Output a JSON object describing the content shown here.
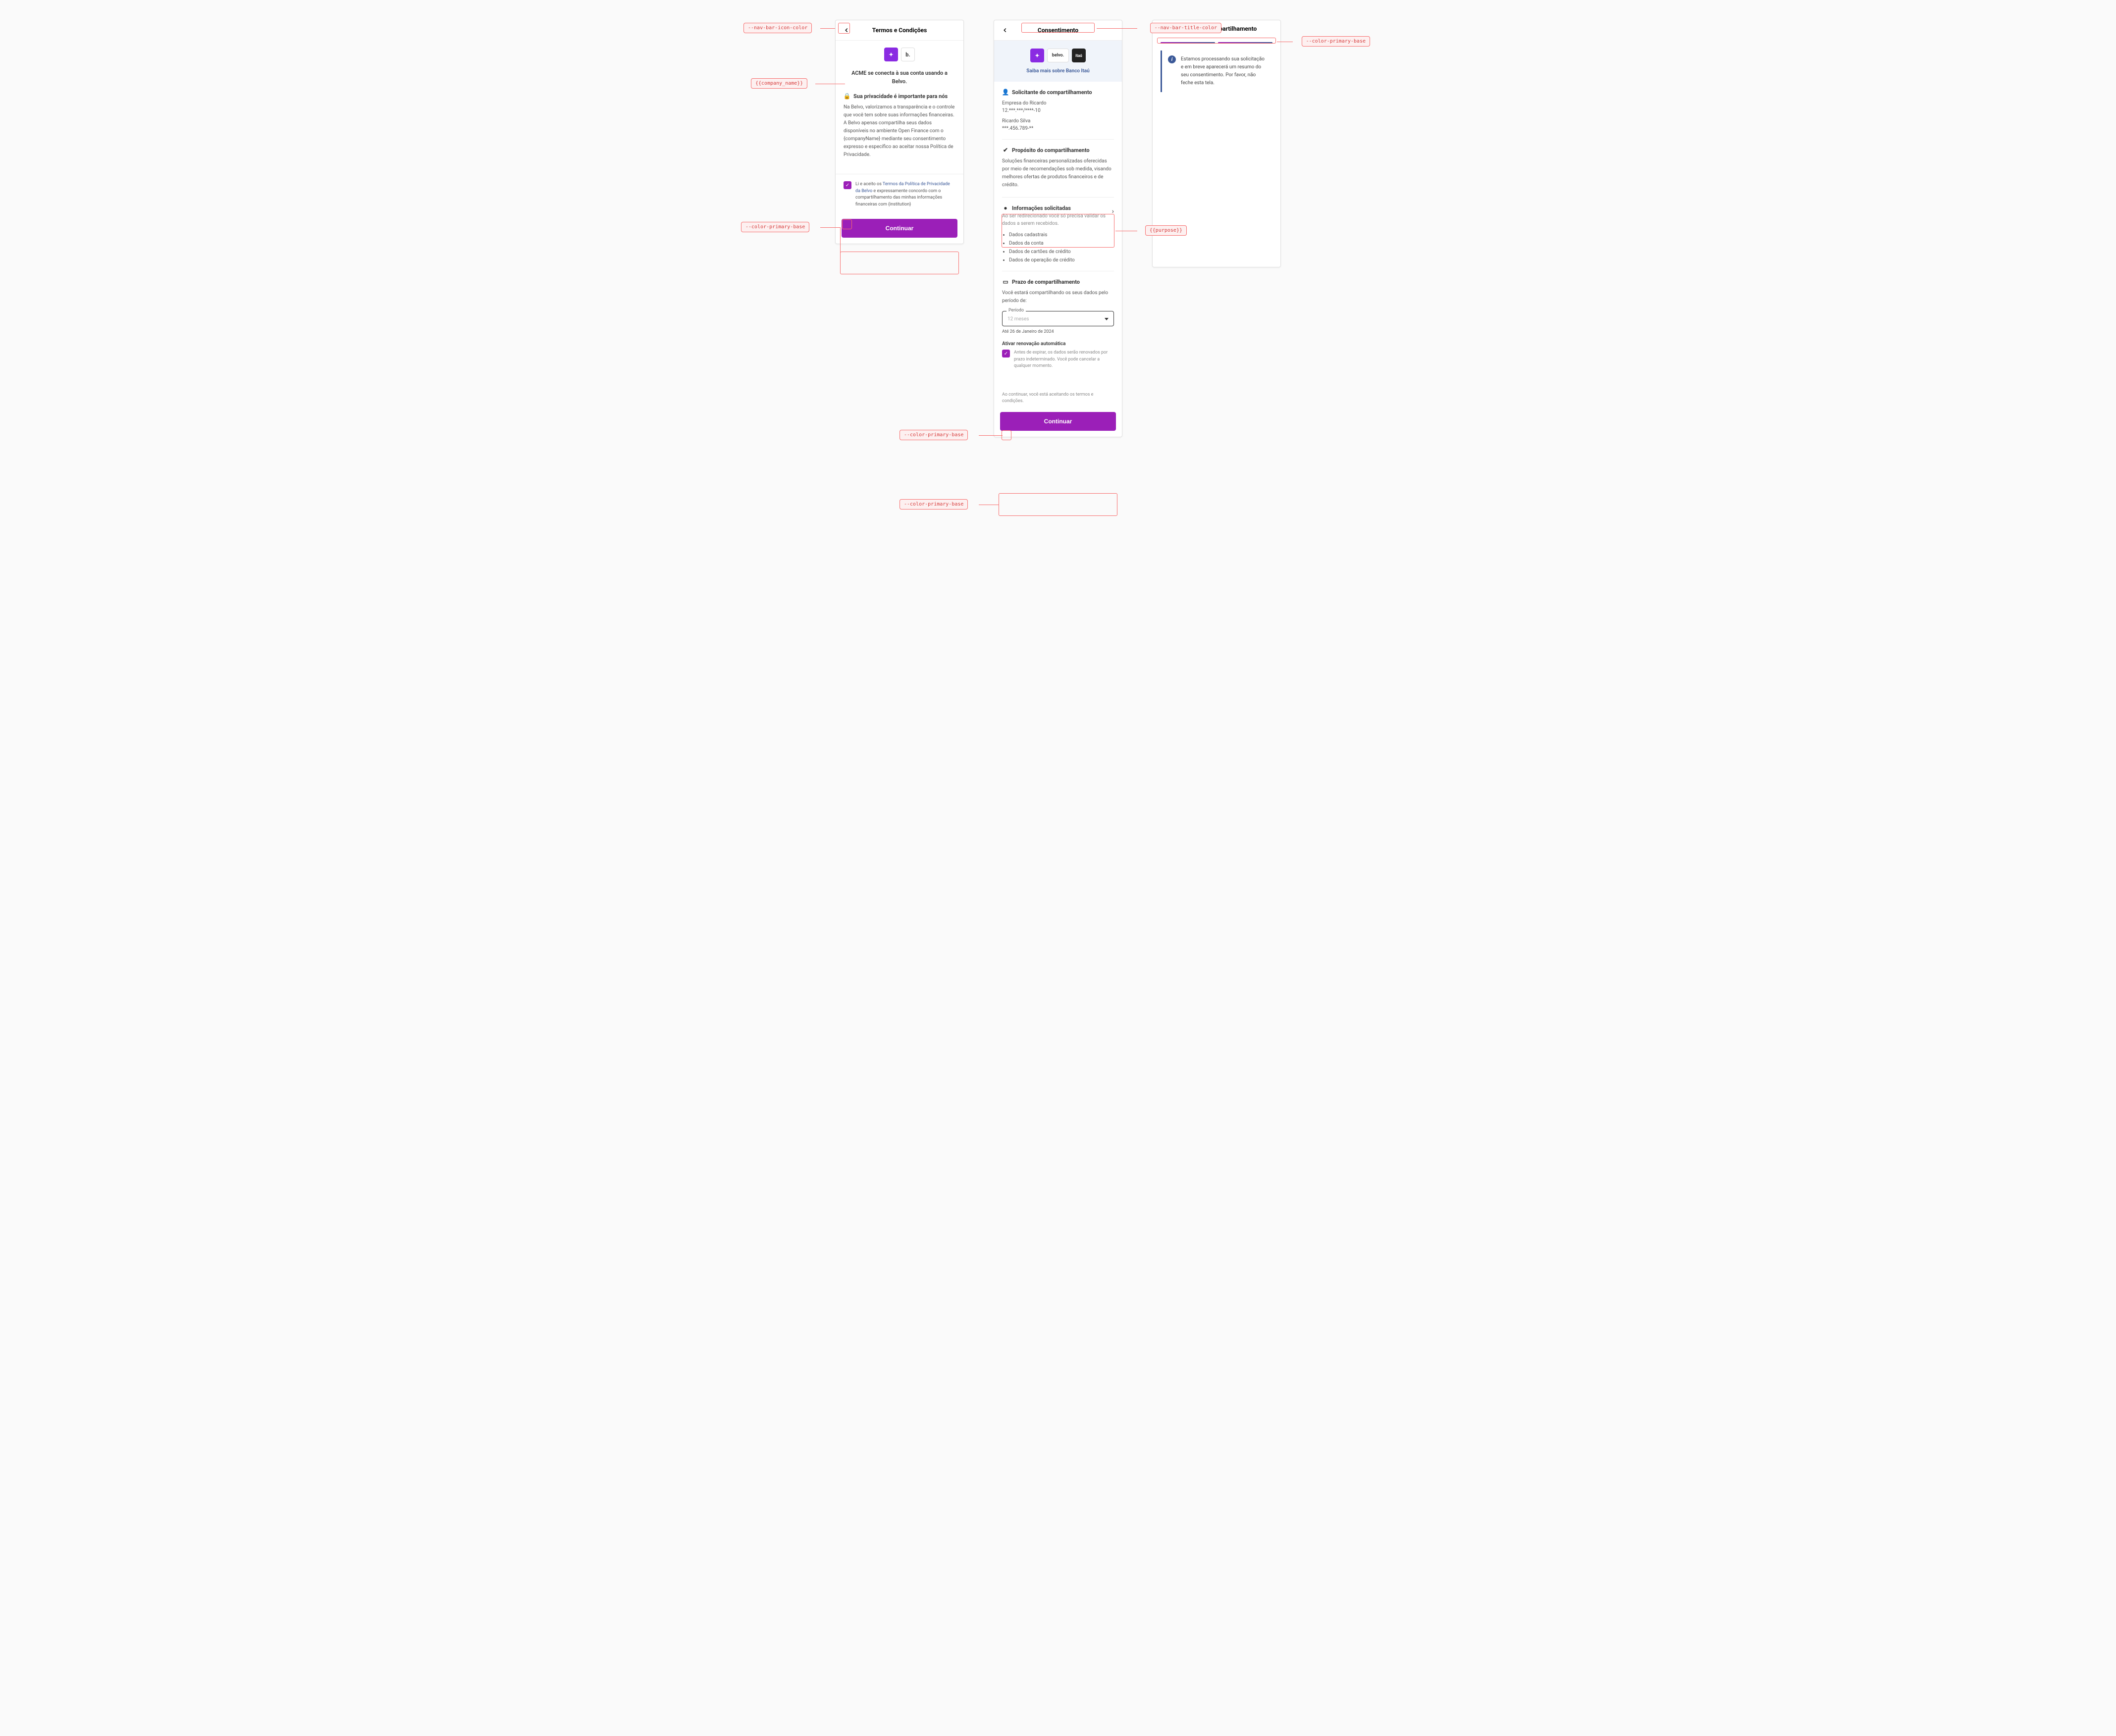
{
  "annotations": {
    "nav_bar_icon_color": "--nav-bar-icon-color",
    "company_name": "{{company_name}}",
    "color_primary_base": "--color-primary-base",
    "nav_bar_title_color": "--nav-bar-title-color",
    "purpose": "{{purpose}}"
  },
  "screen1": {
    "title": "Termos e Condições",
    "connect_text": "ACME se conecta à sua conta usando a Belvo.",
    "privacy_title": "Sua privacidade é importante para nós",
    "privacy_body": "Na Belvo, valorizamos a transparência e o controle que você tem sobre suas informações financeiras. A Belvo apenas compartilha seus dados disponíveis no ambiente Open Finance com o {companyName} mediante seu consentimento expresso e específico ao aceitar nossa Política de Privacidade.",
    "consent_prefix": "Li e aceito os ",
    "consent_link": "Termos da Política de Privacidade da Belvo",
    "consent_suffix": " e expressamente concordo com o compartilhamento das minhas informações financeiras com {institution}",
    "cta": "Continuar"
  },
  "screen2": {
    "title": "Consentimento",
    "learn_more": "Saiba mais sobre Banco Itaú",
    "requester_title": "Solicitante do compartilhamento",
    "requester": {
      "company_name": "Empresa do Ricardo",
      "company_id": "12.***.***/****-10",
      "person_name": "Ricardo Silva",
      "person_id": "***.456.789-**"
    },
    "purpose_title": "Propósito do compartilhamento",
    "purpose_body": "Soluções financeiras personalizadas oferecidas por meio de recomendações sob medida, visando melhores ofertas de produtos financeiros e de crédito.",
    "info_title": "Informações solicitadas",
    "info_sub": "Ao ser redirecionado você só precisa validar os dados a serem recebidos.",
    "info_items": [
      "Dados cadastrais",
      "Dados da conta",
      "Dados de cartões de crédito",
      "Dados de operação de crédito"
    ],
    "period_title": "Prazo de compartilhamento",
    "period_intro": "Você estará compartilhando os seus dados pelo período de:",
    "period_label": "Período",
    "period_value": "12 meses",
    "period_until": "Até 26 de Janeiro de 2024",
    "renew_title": "Ativar renovação automática",
    "renew_body": "Antes de expirar, os dados serão renovados por prazo indeterminado. Você pode cancelar a qualquer momento.",
    "footer_note": "Ao continuar, você está aceitando os termos e condições.",
    "cta": "Continuar"
  },
  "screen3": {
    "title": "Resumo de compartilhamento",
    "processing_text": "Estamos processando sua solicitação e em breve aparecerá um resumo do seu consentimento. Por favor, não feche esta tela."
  }
}
